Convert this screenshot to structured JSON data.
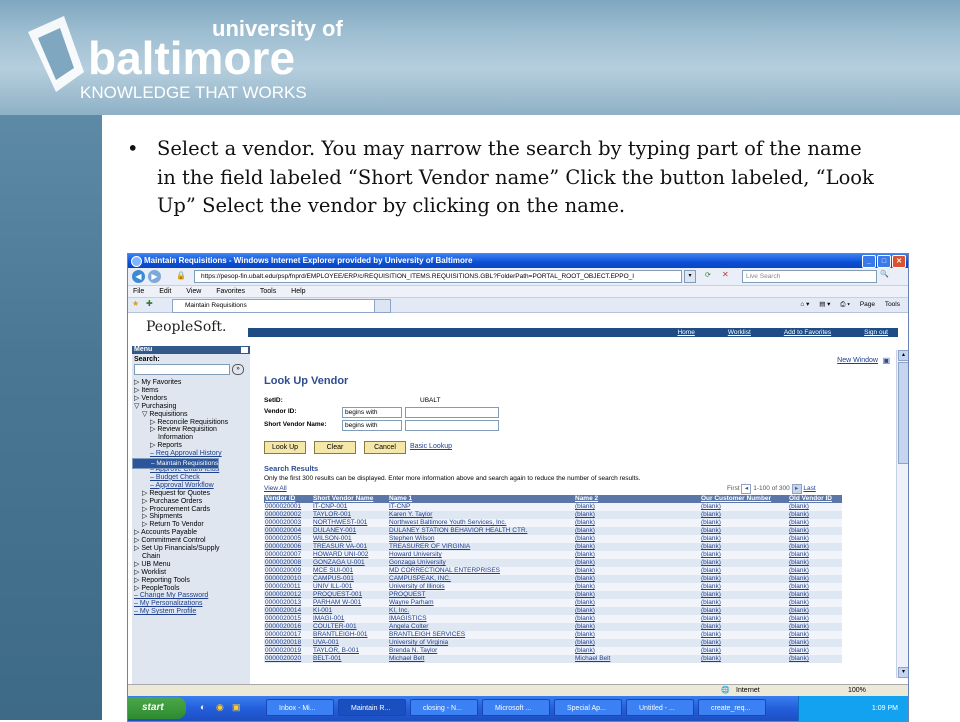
{
  "slide": {
    "logo_line1": "university of",
    "logo_line2": "baltimore",
    "logo_tagline": "KNOWLEDGE THAT WORKS",
    "bullet_text": "Select a vendor.  You may narrow the search by typing part of the name in the field labeled “Short Vendor name” Click the button labeled, “Look Up”  Select the vendor by clicking on the name."
  },
  "browser": {
    "title": "Maintain Requisitions - Windows Internet Explorer provided by University of Baltimore",
    "address": "https://pesop-fin.ubalt.edu/psp/fnprd/EMPLOYEE/ERP/c/REQUISITION_ITEMS.REQUISITIONS.GBL?FolderPath=PORTAL_ROOT_OBJECT.EPPO_I",
    "live_search_placeholder": "Live Search",
    "menu": [
      "File",
      "Edit",
      "View",
      "Favorites",
      "Tools",
      "Help"
    ],
    "tab_label": "Maintain Requisitions",
    "cmd_page": "Page",
    "cmd_tools": "Tools"
  },
  "ps": {
    "logo": "PeopleSoft.",
    "links": [
      "Home",
      "Worklist",
      "Add to Favorites",
      "Sign out"
    ],
    "new_window": "New Window",
    "menu_title": "Menu",
    "search_label": "Search:",
    "menu_items": [
      {
        "label": "▷ My Favorites",
        "kind": "n",
        "indent": 0
      },
      {
        "label": "▷ Items",
        "kind": "n",
        "indent": 0
      },
      {
        "label": "▷ Vendors",
        "kind": "n",
        "indent": 0
      },
      {
        "label": "▽ Purchasing",
        "kind": "n",
        "indent": 0
      },
      {
        "label": "▽ Requisitions",
        "kind": "n",
        "indent": 1
      },
      {
        "label": "▷ Reconcile Requisitions",
        "kind": "n",
        "indent": 2
      },
      {
        "label": "▷ Review Requisition",
        "kind": "n",
        "indent": 2
      },
      {
        "label": "Information",
        "kind": "n",
        "indent": 3
      },
      {
        "label": "▷ Reports",
        "kind": "n",
        "indent": 2
      },
      {
        "label": "– Req Approval History",
        "kind": "l",
        "indent": 2
      },
      {
        "label": "– Maintain Requisitions",
        "kind": "s",
        "indent": 2
      },
      {
        "label": "– Approve Amounts",
        "kind": "l",
        "indent": 2
      },
      {
        "label": "– Approve ChartFields",
        "kind": "l",
        "indent": 2
      },
      {
        "label": "– Budget Check",
        "kind": "l",
        "indent": 2
      },
      {
        "label": "– Approval Workflow",
        "kind": "l",
        "indent": 2
      },
      {
        "label": "▷ Request for Quotes",
        "kind": "n",
        "indent": 1
      },
      {
        "label": "▷ Purchase Orders",
        "kind": "n",
        "indent": 1
      },
      {
        "label": "▷ Procurement Cards",
        "kind": "n",
        "indent": 1
      },
      {
        "label": "▷ Shipments",
        "kind": "n",
        "indent": 1
      },
      {
        "label": "▷ Return To Vendor",
        "kind": "n",
        "indent": 1
      },
      {
        "label": "▷ Accounts Payable",
        "kind": "n",
        "indent": 0
      },
      {
        "label": "▷ Commitment Control",
        "kind": "n",
        "indent": 0
      },
      {
        "label": "▷ Set Up Financials/Supply",
        "kind": "n",
        "indent": 0
      },
      {
        "label": "Chain",
        "kind": "n",
        "indent": 1
      },
      {
        "label": "▷ UB Menu",
        "kind": "n",
        "indent": 0
      },
      {
        "label": "▷ Worklist",
        "kind": "n",
        "indent": 0
      },
      {
        "label": "▷ Reporting Tools",
        "kind": "n",
        "indent": 0
      },
      {
        "label": "▷ PeopleTools",
        "kind": "n",
        "indent": 0
      },
      {
        "label": "– Change My Password",
        "kind": "l",
        "indent": 0
      },
      {
        "label": "– My Personalizations",
        "kind": "l",
        "indent": 0
      },
      {
        "label": "– My System Profile",
        "kind": "l",
        "indent": 0
      }
    ],
    "page_title": "Look Up Vendor",
    "setid_label": "SetID:",
    "setid_value": "UBALT",
    "vendor_id_label": "Vendor ID:",
    "short_name_label": "Short Vendor Name:",
    "operator": "begins with",
    "lookup_btn": "Look Up",
    "clear_btn": "Clear",
    "cancel_btn": "Cancel",
    "basic_lookup": "Basic Lookup",
    "results_title": "Search Results",
    "results_note": "Only the first 300 results can be displayed. Enter more information above and search again to reduce the number of search results.",
    "view_all": "View All",
    "pager_first": "First",
    "pager_range": "1-100 of 300",
    "pager_last": "Last",
    "columns": [
      "Vendor ID",
      "Short Vendor Name",
      "Name 1",
      "Name 2",
      "Our Customer Number",
      "Old Vendor ID"
    ],
    "rows": [
      [
        "0000020001",
        "IT-CNP-001",
        "IT-CNP",
        "(blank)",
        "(blank)",
        "(blank)"
      ],
      [
        "0000020002",
        "TAYLOR-001",
        "Karen Y. Taylor",
        "(blank)",
        "(blank)",
        "(blank)"
      ],
      [
        "0000020003",
        "NORTHWEST-001",
        "Northwest Baltimore Youth Services, Inc.",
        "(blank)",
        "(blank)",
        "(blank)"
      ],
      [
        "0000020004",
        "DULANEY-001",
        "DULANEY STATION BEHAVIOR HEALTH CTR.",
        "(blank)",
        "(blank)",
        "(blank)"
      ],
      [
        "0000020005",
        "WILSON-001",
        "Stephen Wilson",
        "(blank)",
        "(blank)",
        "(blank)"
      ],
      [
        "0000020006",
        "TREASUR VA-001",
        "TREASURER OF VIRGINIA",
        "(blank)",
        "(blank)",
        "(blank)"
      ],
      [
        "0000020007",
        "HOWARD UNI-002",
        "Howard University",
        "(blank)",
        "(blank)",
        "(blank)"
      ],
      [
        "0000020008",
        "GONZAGA U-001",
        "Gonzaga University",
        "(blank)",
        "(blank)",
        "(blank)"
      ],
      [
        "0000020009",
        "MCE SUI-001",
        "MD CORRECTIONAL ENTERPRISES",
        "(blank)",
        "(blank)",
        "(blank)"
      ],
      [
        "0000020010",
        "CAMPUS-001",
        "CAMPUSPEAK, INC.",
        "(blank)",
        "(blank)",
        "(blank)"
      ],
      [
        "0000020011",
        "UNIV ILL-001",
        "University of Illinois",
        "(blank)",
        "(blank)",
        "(blank)"
      ],
      [
        "0000020012",
        "PROQUEST-001",
        "PROQUEST",
        "(blank)",
        "(blank)",
        "(blank)"
      ],
      [
        "0000020013",
        "PARHAM W-001",
        "Wayne Parham",
        "(blank)",
        "(blank)",
        "(blank)"
      ],
      [
        "0000020014",
        "KI-001",
        "KI, Inc.",
        "(blank)",
        "(blank)",
        "(blank)"
      ],
      [
        "0000020015",
        "IMAGI-001",
        "IMAGISTICS",
        "(blank)",
        "(blank)",
        "(blank)"
      ],
      [
        "0000020016",
        "COULTER-001",
        "Angela Colter",
        "(blank)",
        "(blank)",
        "(blank)"
      ],
      [
        "0000020017",
        "BRANTLEIGH-001",
        "BRANTLEIGH SERVICES",
        "(blank)",
        "(blank)",
        "(blank)"
      ],
      [
        "0000020018",
        "UVA-001",
        "University of Virginia",
        "(blank)",
        "(blank)",
        "(blank)"
      ],
      [
        "0000020019",
        "TAYLOR, B-001",
        "Brenda N. Taylor",
        "(blank)",
        "(blank)",
        "(blank)"
      ],
      [
        "0000020020",
        "BELT-001",
        "Michael Belt",
        "Michael Belt",
        "(blank)",
        "(blank)"
      ]
    ]
  },
  "status": {
    "zone": "Internet",
    "zoom": "100%"
  },
  "taskbar": {
    "start": "start",
    "items": [
      "Inbox - Mi...",
      "Maintain R...",
      "closing - N...",
      "Microsoft ...",
      "Special Ap...",
      "Untitled - ...",
      "create_req..."
    ],
    "clock": "1:09 PM"
  },
  "colors": {
    "accent": "#2e4c8f",
    "header_bar": "#5b76a8",
    "selected_menu": "#2c559b"
  }
}
